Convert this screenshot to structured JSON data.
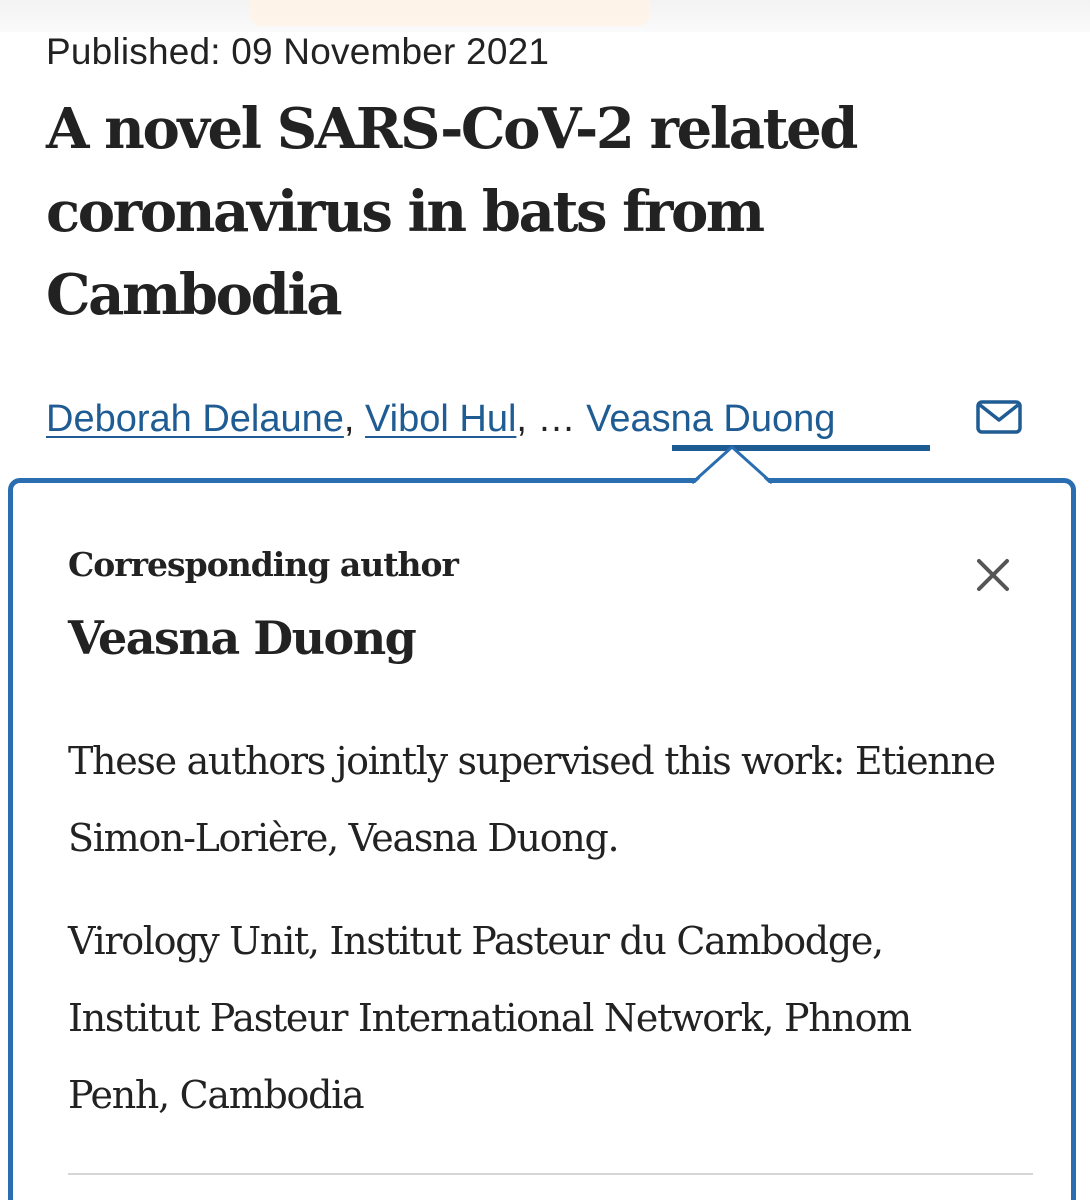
{
  "article": {
    "published": "Published: 09 November 2021",
    "title": "A novel SARS-CoV-2 related coronavirus in bats from Cambodia"
  },
  "authors": {
    "first": "Deborah Delaune",
    "second": "Vibol Hul",
    "sep1": ", ",
    "sep2": ", … ",
    "last": "Veasna Duong",
    "mail_icon": "mail-icon"
  },
  "popup": {
    "label": "Corresponding author",
    "name": "Veasna Duong",
    "note": "These authors jointly supervised this work: Etienne Simon-Lorière, Veasna Duong.",
    "affiliation": "Virology Unit, Institut Pasteur du Cambodge, Institut Pasteur International Network, Phnom Penh, Cambodia",
    "close_icon": "close-icon"
  },
  "colors": {
    "link": "#1f5c93",
    "popup_border": "#2a6db0",
    "text": "#222222"
  }
}
